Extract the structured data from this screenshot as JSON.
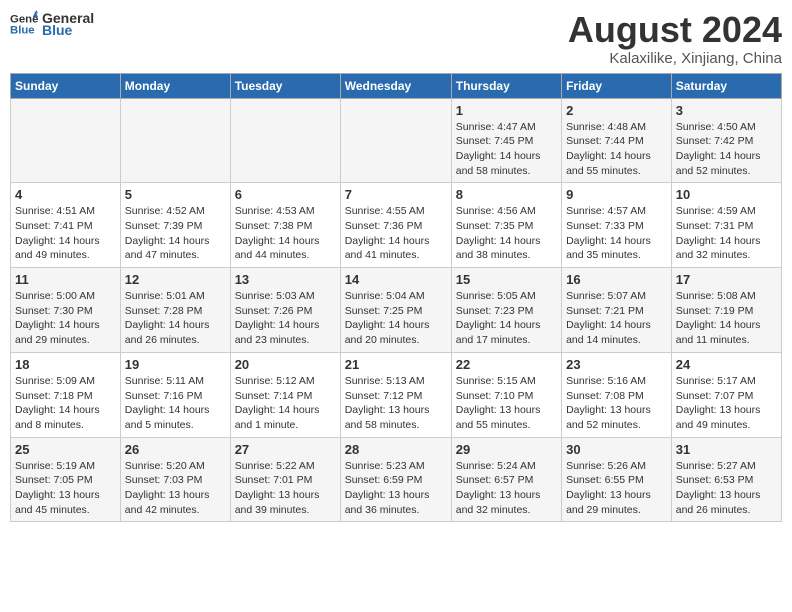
{
  "header": {
    "logo_general": "General",
    "logo_blue": "Blue",
    "month_title": "August 2024",
    "location": "Kalaxilike, Xinjiang, China"
  },
  "weekdays": [
    "Sunday",
    "Monday",
    "Tuesday",
    "Wednesday",
    "Thursday",
    "Friday",
    "Saturday"
  ],
  "weeks": [
    [
      {
        "day": "",
        "sunrise": "",
        "sunset": "",
        "daylight": ""
      },
      {
        "day": "",
        "sunrise": "",
        "sunset": "",
        "daylight": ""
      },
      {
        "day": "",
        "sunrise": "",
        "sunset": "",
        "daylight": ""
      },
      {
        "day": "",
        "sunrise": "",
        "sunset": "",
        "daylight": ""
      },
      {
        "day": "1",
        "sunrise": "Sunrise: 4:47 AM",
        "sunset": "Sunset: 7:45 PM",
        "daylight": "Daylight: 14 hours and 58 minutes."
      },
      {
        "day": "2",
        "sunrise": "Sunrise: 4:48 AM",
        "sunset": "Sunset: 7:44 PM",
        "daylight": "Daylight: 14 hours and 55 minutes."
      },
      {
        "day": "3",
        "sunrise": "Sunrise: 4:50 AM",
        "sunset": "Sunset: 7:42 PM",
        "daylight": "Daylight: 14 hours and 52 minutes."
      }
    ],
    [
      {
        "day": "4",
        "sunrise": "Sunrise: 4:51 AM",
        "sunset": "Sunset: 7:41 PM",
        "daylight": "Daylight: 14 hours and 49 minutes."
      },
      {
        "day": "5",
        "sunrise": "Sunrise: 4:52 AM",
        "sunset": "Sunset: 7:39 PM",
        "daylight": "Daylight: 14 hours and 47 minutes."
      },
      {
        "day": "6",
        "sunrise": "Sunrise: 4:53 AM",
        "sunset": "Sunset: 7:38 PM",
        "daylight": "Daylight: 14 hours and 44 minutes."
      },
      {
        "day": "7",
        "sunrise": "Sunrise: 4:55 AM",
        "sunset": "Sunset: 7:36 PM",
        "daylight": "Daylight: 14 hours and 41 minutes."
      },
      {
        "day": "8",
        "sunrise": "Sunrise: 4:56 AM",
        "sunset": "Sunset: 7:35 PM",
        "daylight": "Daylight: 14 hours and 38 minutes."
      },
      {
        "day": "9",
        "sunrise": "Sunrise: 4:57 AM",
        "sunset": "Sunset: 7:33 PM",
        "daylight": "Daylight: 14 hours and 35 minutes."
      },
      {
        "day": "10",
        "sunrise": "Sunrise: 4:59 AM",
        "sunset": "Sunset: 7:31 PM",
        "daylight": "Daylight: 14 hours and 32 minutes."
      }
    ],
    [
      {
        "day": "11",
        "sunrise": "Sunrise: 5:00 AM",
        "sunset": "Sunset: 7:30 PM",
        "daylight": "Daylight: 14 hours and 29 minutes."
      },
      {
        "day": "12",
        "sunrise": "Sunrise: 5:01 AM",
        "sunset": "Sunset: 7:28 PM",
        "daylight": "Daylight: 14 hours and 26 minutes."
      },
      {
        "day": "13",
        "sunrise": "Sunrise: 5:03 AM",
        "sunset": "Sunset: 7:26 PM",
        "daylight": "Daylight: 14 hours and 23 minutes."
      },
      {
        "day": "14",
        "sunrise": "Sunrise: 5:04 AM",
        "sunset": "Sunset: 7:25 PM",
        "daylight": "Daylight: 14 hours and 20 minutes."
      },
      {
        "day": "15",
        "sunrise": "Sunrise: 5:05 AM",
        "sunset": "Sunset: 7:23 PM",
        "daylight": "Daylight: 14 hours and 17 minutes."
      },
      {
        "day": "16",
        "sunrise": "Sunrise: 5:07 AM",
        "sunset": "Sunset: 7:21 PM",
        "daylight": "Daylight: 14 hours and 14 minutes."
      },
      {
        "day": "17",
        "sunrise": "Sunrise: 5:08 AM",
        "sunset": "Sunset: 7:19 PM",
        "daylight": "Daylight: 14 hours and 11 minutes."
      }
    ],
    [
      {
        "day": "18",
        "sunrise": "Sunrise: 5:09 AM",
        "sunset": "Sunset: 7:18 PM",
        "daylight": "Daylight: 14 hours and 8 minutes."
      },
      {
        "day": "19",
        "sunrise": "Sunrise: 5:11 AM",
        "sunset": "Sunset: 7:16 PM",
        "daylight": "Daylight: 14 hours and 5 minutes."
      },
      {
        "day": "20",
        "sunrise": "Sunrise: 5:12 AM",
        "sunset": "Sunset: 7:14 PM",
        "daylight": "Daylight: 14 hours and 1 minute."
      },
      {
        "day": "21",
        "sunrise": "Sunrise: 5:13 AM",
        "sunset": "Sunset: 7:12 PM",
        "daylight": "Daylight: 13 hours and 58 minutes."
      },
      {
        "day": "22",
        "sunrise": "Sunrise: 5:15 AM",
        "sunset": "Sunset: 7:10 PM",
        "daylight": "Daylight: 13 hours and 55 minutes."
      },
      {
        "day": "23",
        "sunrise": "Sunrise: 5:16 AM",
        "sunset": "Sunset: 7:08 PM",
        "daylight": "Daylight: 13 hours and 52 minutes."
      },
      {
        "day": "24",
        "sunrise": "Sunrise: 5:17 AM",
        "sunset": "Sunset: 7:07 PM",
        "daylight": "Daylight: 13 hours and 49 minutes."
      }
    ],
    [
      {
        "day": "25",
        "sunrise": "Sunrise: 5:19 AM",
        "sunset": "Sunset: 7:05 PM",
        "daylight": "Daylight: 13 hours and 45 minutes."
      },
      {
        "day": "26",
        "sunrise": "Sunrise: 5:20 AM",
        "sunset": "Sunset: 7:03 PM",
        "daylight": "Daylight: 13 hours and 42 minutes."
      },
      {
        "day": "27",
        "sunrise": "Sunrise: 5:22 AM",
        "sunset": "Sunset: 7:01 PM",
        "daylight": "Daylight: 13 hours and 39 minutes."
      },
      {
        "day": "28",
        "sunrise": "Sunrise: 5:23 AM",
        "sunset": "Sunset: 6:59 PM",
        "daylight": "Daylight: 13 hours and 36 minutes."
      },
      {
        "day": "29",
        "sunrise": "Sunrise: 5:24 AM",
        "sunset": "Sunset: 6:57 PM",
        "daylight": "Daylight: 13 hours and 32 minutes."
      },
      {
        "day": "30",
        "sunrise": "Sunrise: 5:26 AM",
        "sunset": "Sunset: 6:55 PM",
        "daylight": "Daylight: 13 hours and 29 minutes."
      },
      {
        "day": "31",
        "sunrise": "Sunrise: 5:27 AM",
        "sunset": "Sunset: 6:53 PM",
        "daylight": "Daylight: 13 hours and 26 minutes."
      }
    ]
  ]
}
